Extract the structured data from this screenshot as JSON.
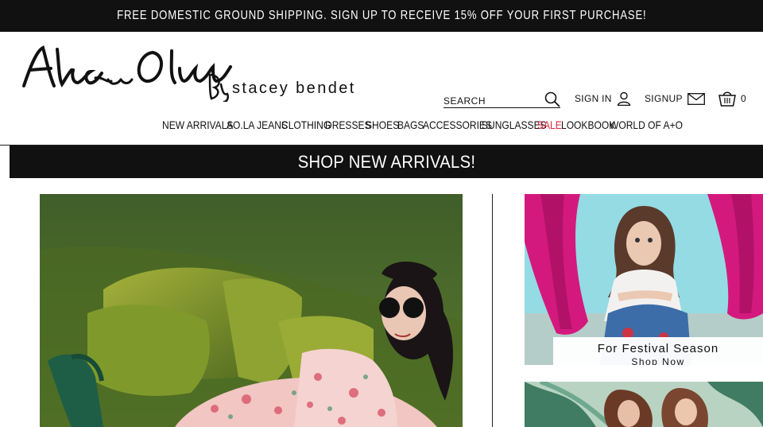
{
  "promo": {
    "text": "FREE DOMESTIC GROUND SHIPPING. SIGN UP TO RECEIVE 15% OFF YOUR FIRST PURCHASE!"
  },
  "logo": {
    "script": "Alice and Olivia",
    "by": "By",
    "designer": "stacey bendet"
  },
  "header": {
    "search_placeholder": "SEARCH",
    "signin_label": "SIGN IN",
    "signup_label": "SIGNUP",
    "cart_count": "0"
  },
  "nav": {
    "items": [
      {
        "label": "NEW ARRIVALS"
      },
      {
        "label": "AO.LA JEANS"
      },
      {
        "label": "CLOTHING"
      },
      {
        "label": "DRESSES"
      },
      {
        "label": "SHOES"
      },
      {
        "label": "BAGS"
      },
      {
        "label": "ACCESSORIES"
      },
      {
        "label": "SUNGLASSES"
      },
      {
        "label": "SALE"
      },
      {
        "label": "LOOKBOOK"
      },
      {
        "label": "WORLD OF A+O"
      }
    ]
  },
  "hero": {
    "title": "SHOP NEW ARRIVALS!"
  },
  "tiles": {
    "festival_title": "For Festival Season",
    "festival_link": "Shop Now"
  },
  "colors": {
    "promo_bg": "#111111",
    "sale": "#e0243b",
    "tile_accent_magenta": "#d4197e"
  }
}
